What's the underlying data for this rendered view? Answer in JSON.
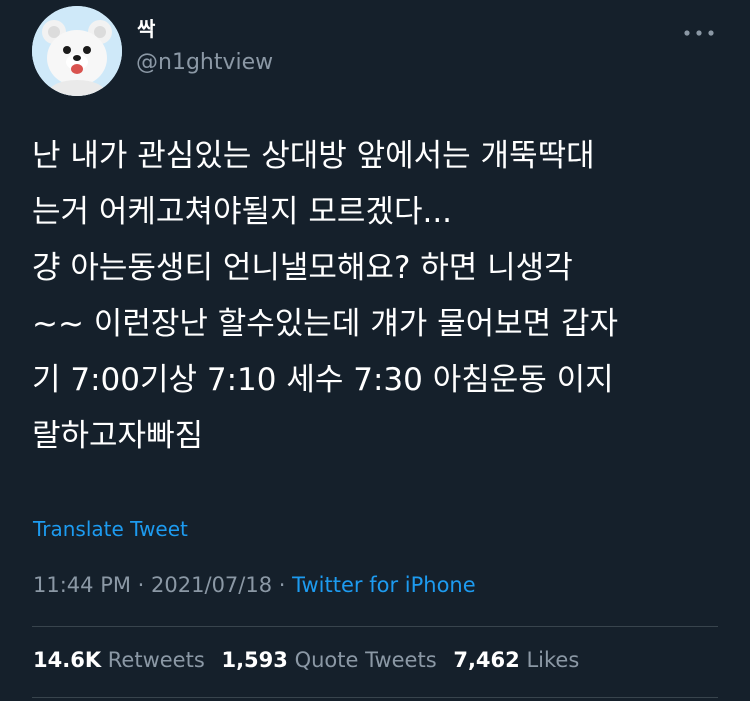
{
  "author": {
    "display_name": "싹",
    "handle": "@n1ghtview",
    "avatar_icon": "white-teddy-bear-avatar"
  },
  "more_icon": "more-horizontal-icon",
  "tweet": {
    "lines": [
      "난 내가 관심있는 상대방 앞에서는 개뚝딱대",
      "는거 어케고쳐야될지 모르겠다...",
      "걍 아는동생티 언니낼모해요? 하면 니생각",
      "~~ 이런장난 할수있는데 걔가 물어보면 갑자",
      "기 7:00기상 7:10 세수 7:30 아침운동 이지",
      "랄하고자빠짐"
    ]
  },
  "translate_label": "Translate Tweet",
  "meta": {
    "time": "11:44 PM",
    "date": "2021/07/18",
    "separator": "·",
    "source": "Twitter for iPhone"
  },
  "stats": {
    "retweets": {
      "count": "14.6K",
      "label": "Retweets"
    },
    "quote_tweets": {
      "count": "1,593",
      "label": "Quote Tweets"
    },
    "likes": {
      "count": "7,462",
      "label": "Likes"
    }
  },
  "colors": {
    "background": "#15202b",
    "text": "#ffffff",
    "secondary": "#8b98a5",
    "link": "#1d9bf0",
    "divider": "#38444d"
  }
}
